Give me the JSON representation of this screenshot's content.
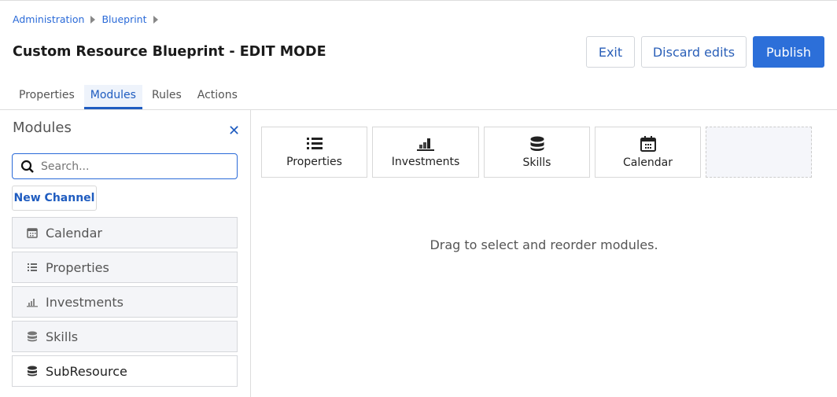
{
  "breadcrumb": [
    "Administration",
    "Blueprint"
  ],
  "title": "Custom Resource Blueprint - EDIT MODE",
  "buttons": {
    "exit": "Exit",
    "discard": "Discard edits",
    "publish": "Publish"
  },
  "tabs": [
    "Properties",
    "Modules",
    "Rules",
    "Actions"
  ],
  "sidebar": {
    "title": "Modules",
    "search_placeholder": "Search...",
    "new_channel": "New Channel",
    "items": [
      "Calendar",
      "Properties",
      "Investments",
      "Skills",
      "SubResource"
    ]
  },
  "main": {
    "tiles": [
      "Properties",
      "Investments",
      "Skills",
      "Calendar"
    ],
    "empty_message": "Drag to select and reorder modules."
  }
}
